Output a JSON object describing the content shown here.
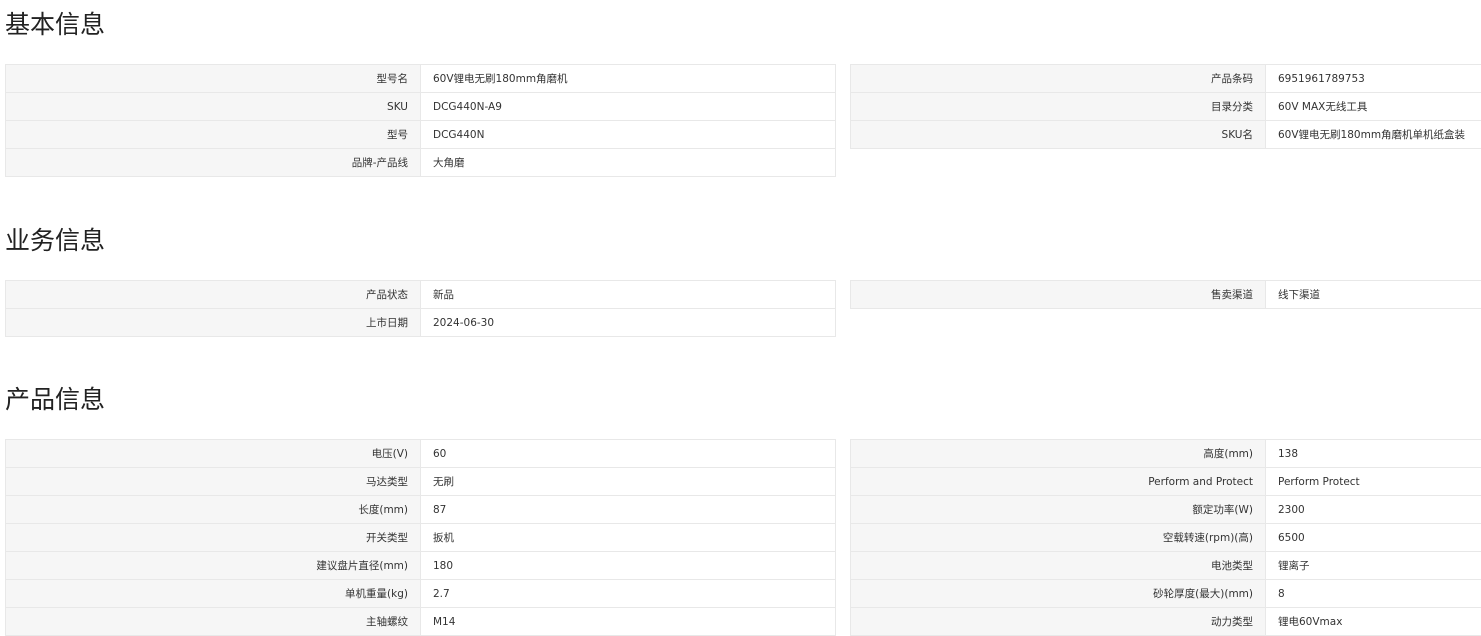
{
  "sections": {
    "basic": {
      "title": "基本信息",
      "left": [
        {
          "label": "型号名",
          "value": "60V锂电无刷180mm角磨机"
        },
        {
          "label": "SKU",
          "value": "DCG440N-A9"
        },
        {
          "label": "型号",
          "value": "DCG440N"
        },
        {
          "label": "品牌-产品线",
          "value": "大角磨"
        }
      ],
      "right": [
        {
          "label": "产品条码",
          "value": "6951961789753"
        },
        {
          "label": "目录分类",
          "value": "60V MAX无线工具"
        },
        {
          "label": "SKU名",
          "value": "60V锂电无刷180mm角磨机单机纸盒装"
        }
      ]
    },
    "business": {
      "title": "业务信息",
      "left": [
        {
          "label": "产品状态",
          "value": "新品"
        },
        {
          "label": "上市日期",
          "value": "2024-06-30"
        }
      ],
      "right": [
        {
          "label": "售卖渠道",
          "value": "线下渠道"
        }
      ]
    },
    "product": {
      "title": "产品信息",
      "left": [
        {
          "label": "电压(V)",
          "value": "60"
        },
        {
          "label": "马达类型",
          "value": "无刷"
        },
        {
          "label": "长度(mm)",
          "value": "87"
        },
        {
          "label": "开关类型",
          "value": "扳机"
        },
        {
          "label": "建议盘片直径(mm)",
          "value": "180"
        },
        {
          "label": "单机重量(kg)",
          "value": "2.7"
        },
        {
          "label": "主轴螺纹",
          "value": "M14"
        }
      ],
      "right": [
        {
          "label": "高度(mm)",
          "value": "138"
        },
        {
          "label": "Perform and Protect",
          "value": "Perform Protect"
        },
        {
          "label": "额定功率(W)",
          "value": "2300"
        },
        {
          "label": "空载转速(rpm)(高)",
          "value": "6500"
        },
        {
          "label": "电池类型",
          "value": "锂离子"
        },
        {
          "label": "砂轮厚度(最大)(mm)",
          "value": "8"
        },
        {
          "label": "动力类型",
          "value": "锂电60Vmax"
        }
      ]
    }
  }
}
